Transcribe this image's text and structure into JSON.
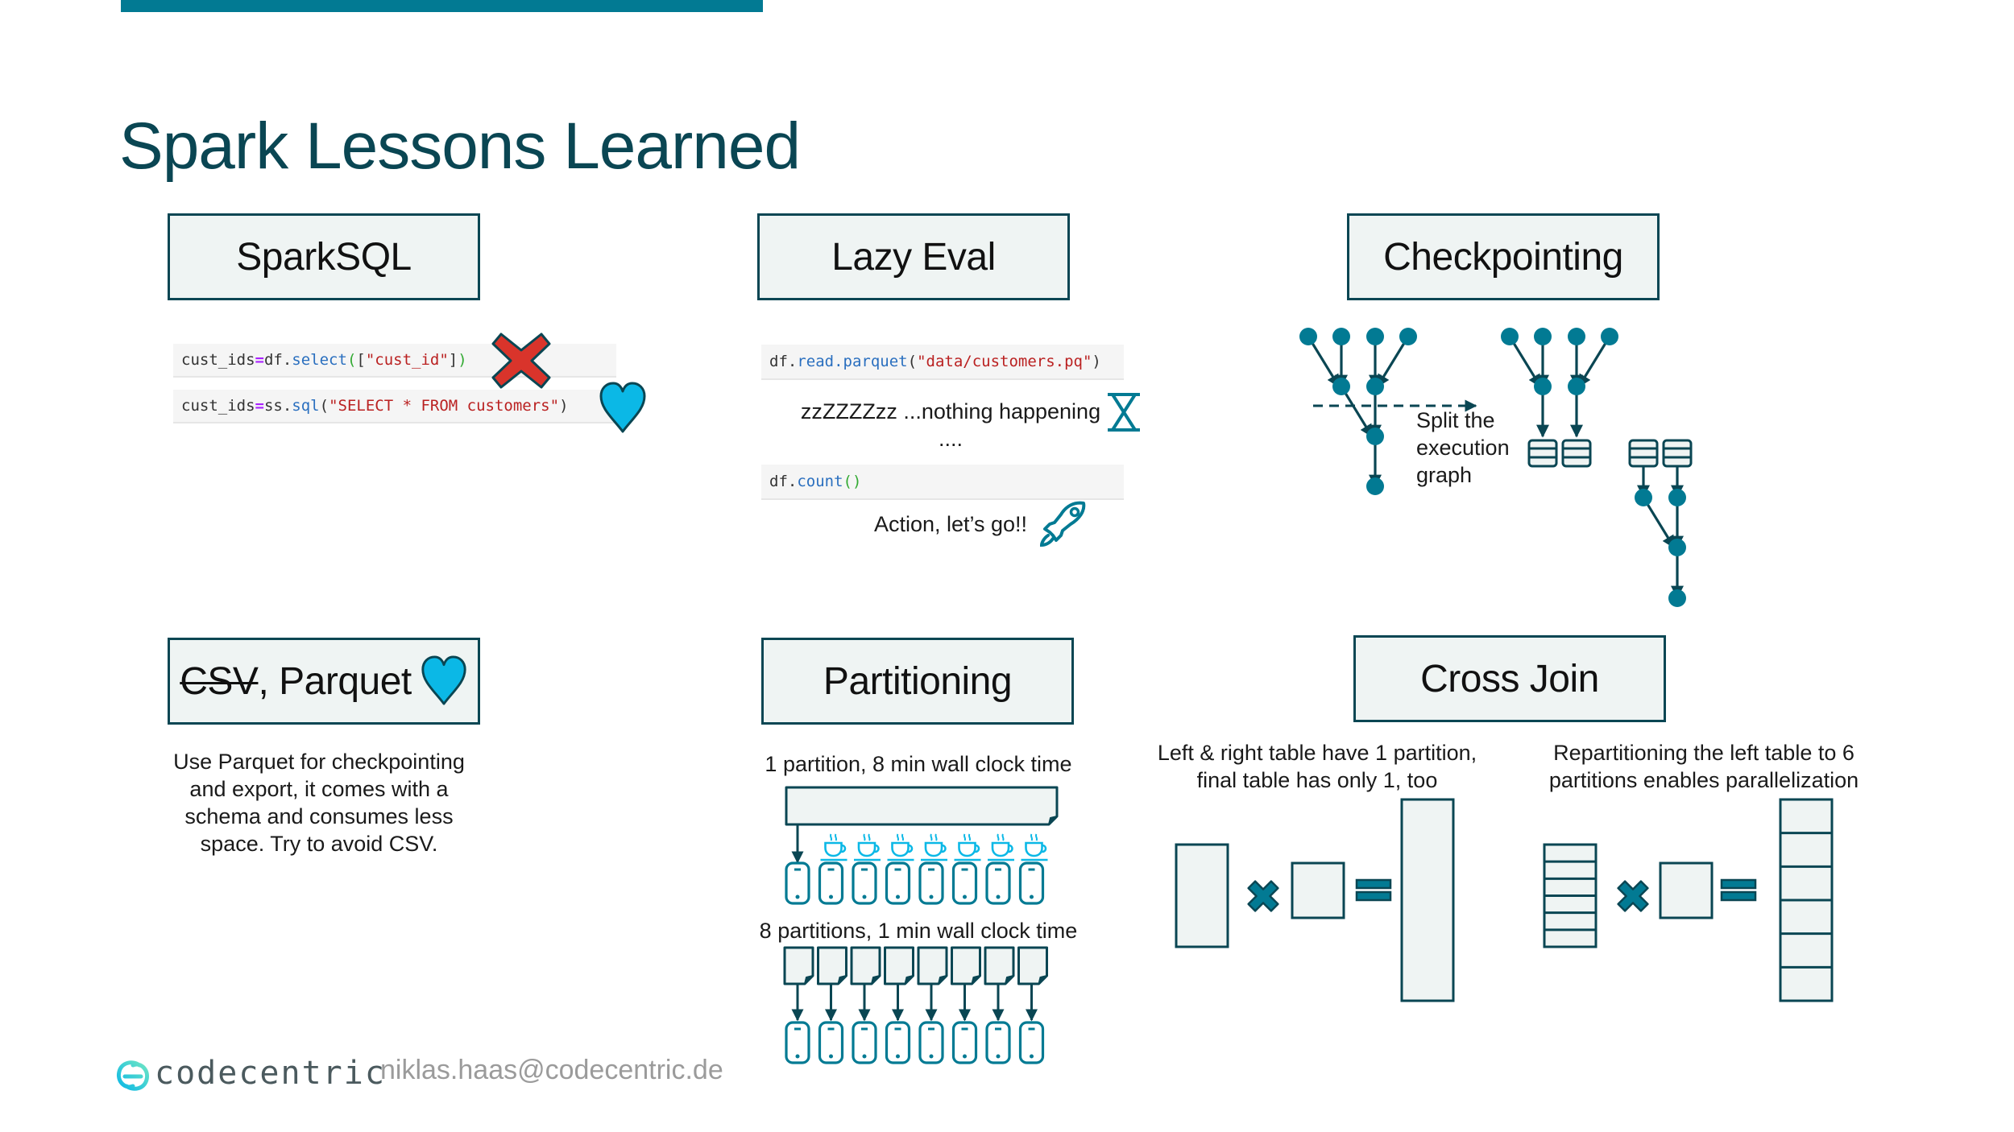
{
  "slide": {
    "title": "Spark Lessons Learned",
    "accent_color": "#027a93",
    "dark_color": "#0a4653",
    "box_fill": "#eff4f3",
    "heart_color": "#0bb8e6",
    "cross_color": "#d9342b"
  },
  "sections": {
    "sparksql": {
      "header": "SparkSQL",
      "code_bad": {
        "var": "cust_ids",
        "op": "=",
        "obj": "df.",
        "fn": "select",
        "open": "(",
        "args_open": "[",
        "str": "\"cust_id\"",
        "args_close": "]",
        "close": ")"
      },
      "code_good": {
        "var": "cust_ids",
        "op": "=",
        "obj": "ss.",
        "fn": "sql",
        "open": "(",
        "str": "\"SELECT * FROM customers\"",
        "close": ")"
      },
      "bad_icon": "red-cross-icon",
      "good_icon": "heart-icon"
    },
    "lazy_eval": {
      "header": "Lazy Eval",
      "code_read": {
        "obj": "df.",
        "fn": "read.parquet",
        "open": "(",
        "str": "\"data/customers.pq\"",
        "close": ")"
      },
      "sleep_text": "zzZZZZzz ...nothing happening",
      "dots": "....",
      "code_count": {
        "obj": "df.",
        "fn": "count",
        "parens": "()"
      },
      "action_text": "Action, let’s go!!",
      "hourglass_icon": "hourglass-icon",
      "rocket_icon": "rocket-icon"
    },
    "checkpointing": {
      "header": "Checkpointing",
      "split_label_lines": [
        "Split the",
        "execution",
        "graph"
      ]
    },
    "file_format": {
      "header_struck": "CSV",
      "header_rest": ", Parquet",
      "description_lines": [
        "Use Parquet for checkpointing",
        "and export, it comes with a",
        "schema and consumes less",
        "space. Try to avoid CSV."
      ]
    },
    "partitioning": {
      "header": "Partitioning",
      "single_label": "1 partition, 8 min wall clock time",
      "multi_label": "8 partitions, 1 min wall clock time",
      "executors": 8,
      "idle_executors": 7
    },
    "cross_join": {
      "header": "Cross Join",
      "left_caption_lines": [
        "Left & right table have 1 partition,",
        "final table has only 1, too"
      ],
      "right_caption_lines": [
        "Repartitioning the left table to 6",
        "partitions enables parallelization"
      ],
      "left_partitions_before": 1,
      "left_partitions_after": 6,
      "result_partitions_after": 6
    }
  },
  "footer": {
    "brand": "codecentric",
    "email": "niklas.haas@codecentric.de"
  }
}
